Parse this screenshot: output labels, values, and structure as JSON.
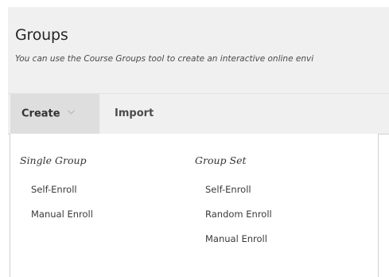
{
  "page": {
    "title": "Groups",
    "subtitle": "You can use the Course Groups tool to create an interactive online envi"
  },
  "toolbar": {
    "create_label": "Create",
    "create_icon": "chevron-down-icon",
    "import_label": "Import"
  },
  "dropdown": {
    "single_group": {
      "heading": "Single Group",
      "items": [
        "Self-Enroll",
        "Manual Enroll"
      ]
    },
    "group_set": {
      "heading": "Group Set",
      "items": [
        "Self-Enroll",
        "Random Enroll",
        "Manual Enroll"
      ]
    }
  },
  "colors": {
    "header_bg": "#f0f0f0",
    "active_button_bg": "#dedede",
    "text": "#333333"
  }
}
